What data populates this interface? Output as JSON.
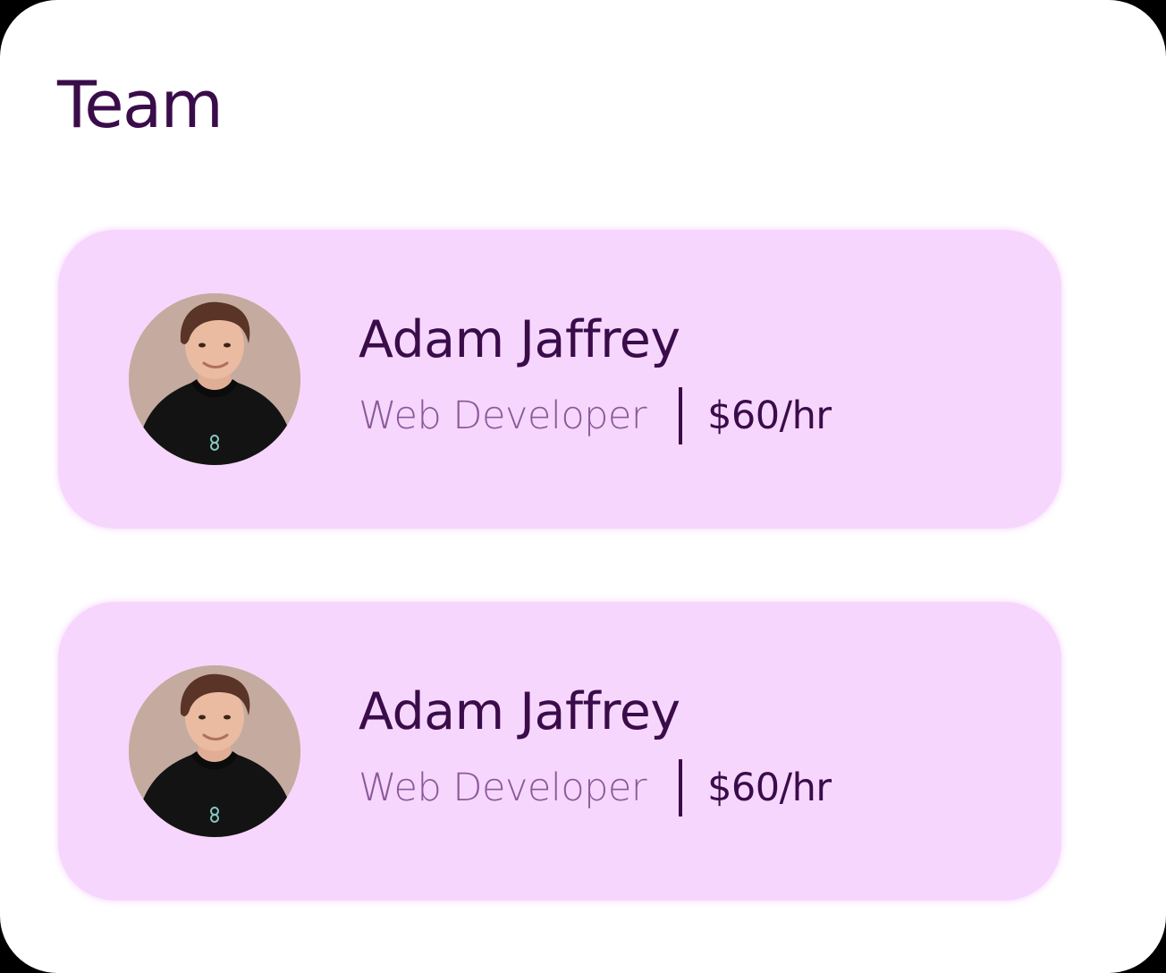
{
  "header": {
    "title": "Team"
  },
  "members": [
    {
      "name": "Adam Jaffrey",
      "role": "Web Developer",
      "rate": "$60/hr",
      "avatar": "avatar-photo"
    },
    {
      "name": "Adam Jaffrey",
      "role": "Web Developer",
      "rate": "$60/hr",
      "avatar": "avatar-photo"
    }
  ],
  "colors": {
    "background": "#ffffff",
    "card": "#f7d6fd",
    "primary_text": "#3a0c4a",
    "secondary_text": "#8a5a98"
  }
}
